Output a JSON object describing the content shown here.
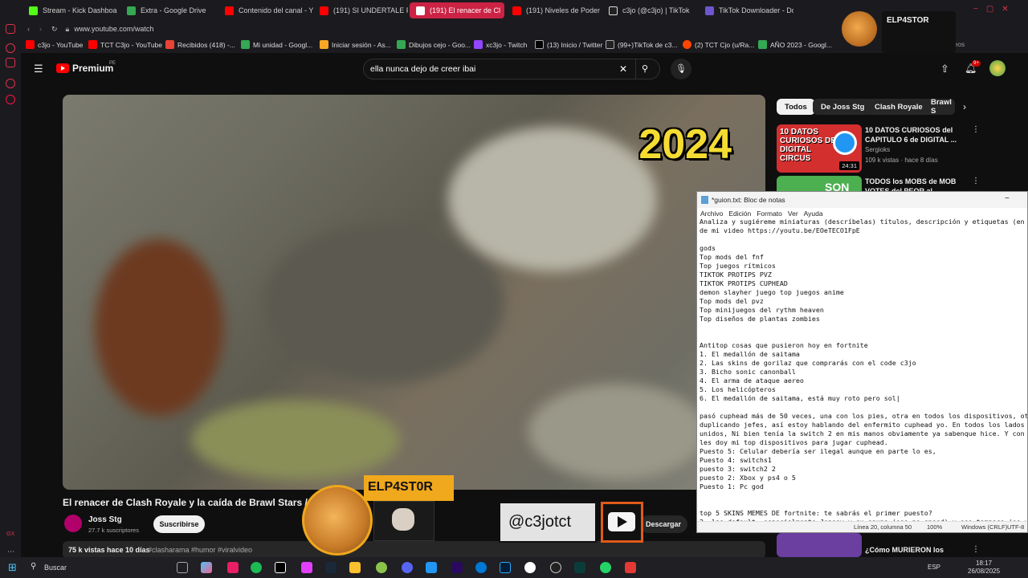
{
  "browser": {
    "tabs": [
      {
        "label": "Stream - Kick Dashboard",
        "color": "#53fc18"
      },
      {
        "label": "Extra - Google Drive",
        "color": "#34a853"
      },
      {
        "label": "Contenido del canal - Yo",
        "color": "#ff0000"
      },
      {
        "label": "(191) SI UNDERTALE FUE",
        "color": "#ff0000"
      },
      {
        "label": "(191) El renacer de Cl",
        "color": "#ff0000"
      },
      {
        "label": "(191) Niveles de Poder de",
        "color": "#ff0000"
      },
      {
        "label": "c3jo (@c3jo) | TikTok",
        "color": "#ffffff"
      },
      {
        "label": "TikTok Downloader - Dow",
        "color": "#6e56cf"
      }
    ],
    "url": "www.youtube.com/watch",
    "bookmarks": [
      "c3jo - YouTube",
      "TCT C3jo - YouTube",
      "Recibidos (418) -...",
      "Mi unidad - Googl...",
      "Iniciar sesión - As...",
      "Dibujos cejo - Goo...",
      "xc3jo - Twitch",
      "(13) Inicio / Twitter",
      "(99+)TikTok de c3...",
      "(2) TCT Cjo (u/Ra...",
      "AÑO 2023 - Googl..."
    ],
    "bookmarks_end": "BotRix | Sorteos"
  },
  "overlay_top": {
    "name": "ELP4STOR"
  },
  "youtube": {
    "logo": "Premium",
    "region": "PE",
    "search_query": "ella nunca dejo de creer ibai",
    "notif_count": "9+",
    "video_year": "2024",
    "video_title": "El renacer de Clash Royale y la caída de Brawl Stars / I",
    "channel": "Joss Stg",
    "subs": "27.7 k suscriptores",
    "subscribe": "Suscribirse",
    "download": "Descargar",
    "stats": "75 k vistas  hace 10 días",
    "tags": " #clasharama #humor #viralvideo",
    "chips": [
      "Todos",
      "De Joss Stg",
      "Clash Royale",
      "Brawl S"
    ],
    "recs": [
      {
        "title": "10 DATOS CURIOSOS del CAPITULO 6 de DIGITAL ...",
        "channel": "Sergioks",
        "meta": "109 k vistas · hace 8 días",
        "duration": "24:31",
        "thumb_text": "10 DATOS CURIOSOS DE DIGITAL CIRCUS"
      },
      {
        "title": "TODOS los MOBS de MOB VOTES del PEOR al MEJOR |",
        "thumb_text": "SON"
      },
      {
        "title": "¿Cómo MURIERON los SUPERS en el PROYECTO KRONOS?"
      }
    ]
  },
  "stream_overlay": {
    "streamer": "ELP4ST0R",
    "handle": "@c3jotct"
  },
  "notepad": {
    "title": "*guion.txt: Bloc de notas",
    "menu": [
      "Archivo",
      "Edición",
      "Formato",
      "Ver",
      "Ayuda"
    ],
    "text": "Analiza y sugiéreme miniaturas (descríbelas) títulos, descripción y etiquetas (en\nde mi video https://youtu.be/EOeTECO1FpE\n\ngods\nTop mods del fnf\nTop juegos rítmicos\nTIKTOK PROTIPS PVZ\nTIKTOK PROTIPS CUPHEAD\ndemon slayher juego top juegos anime\nTop mods del pvz\nTop minijuegos del rythm heaven\nTop diseños de plantas zombies\n\n\nAntitop cosas que pusieron hoy en fortnite\n1. El medallón de saitama\n2. Las skins de gorilaz que comprarás con el code c3jo\n3. Bicho sonic canonball\n4. El arma de ataque aereo\n5. Los helicópteros\n6. El medallón de saitama, está muy roto pero sol|\n\npasó cuphead más de 50 veces, una con los pies, otra en todos los dispositivos, ot\nduplicando jefes, así estoy hablando del enfermito cuphead yo. En todos los lados\nunidos, Ni bien tenía la switch 2 en mis manos obviamente ya sabenque hice. Y con\nles doy mi top dispositivos para jugar cuphead.\nPuesto 5: Celular debería ser ilegal aunque en parte lo es,\nPuesto 4: switchs1\npuesto 3: switch2 2\npuesto 2: Xbox y ps4 o 5\nPuesto 1: Pc god\n\n\ntop 5 SKINS MEMES DE fortnite: te sabrás el primer puesto?\n2. las default, especialmente Jonesy y su sauna (eso no spoed) y eso tampoco (es un",
    "status": {
      "pos": "Línea 20, columna 50",
      "zoom": "100%",
      "eol": "Windows (CRLF)",
      "enc": "UTF-8"
    }
  },
  "taskbar": {
    "search": "Buscar",
    "lang": "ESP",
    "time": "18:17",
    "date": "26/08/2025"
  }
}
